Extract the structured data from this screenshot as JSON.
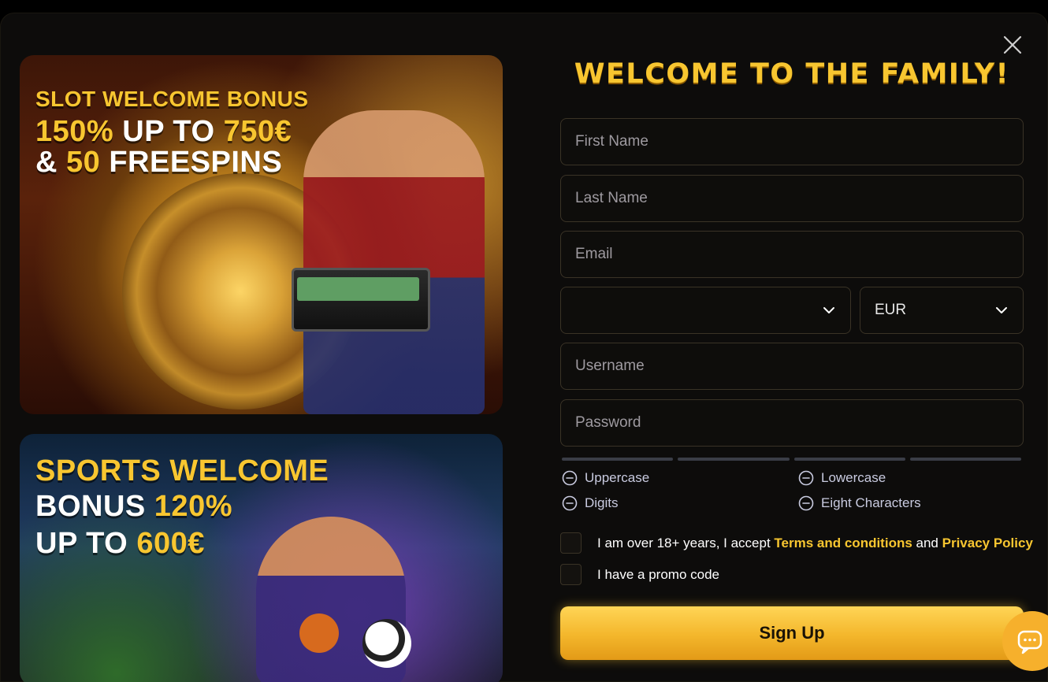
{
  "modal": {
    "title": "WELCOME TO THE FAMILY!"
  },
  "promos": {
    "slot": {
      "line1": "SLOT WELCOME BONUS",
      "line2_a": "150%",
      "line2_b": " UP TO ",
      "line2_c": "750€",
      "line3_a": "& ",
      "line3_b": "50",
      "line3_c": " FREESPINS"
    },
    "sports": {
      "line1": "SPORTS  WELCOME",
      "line2_a": "BONUS ",
      "line2_b": "120%",
      "line3_a": "UP TO ",
      "line3_b": "600€"
    }
  },
  "form": {
    "first_name_placeholder": "First Name",
    "last_name_placeholder": "Last Name",
    "email_placeholder": "Email",
    "country_value": "",
    "currency_value": "EUR",
    "username_placeholder": "Username",
    "password_placeholder": "Password",
    "password_rules": {
      "uppercase": "Uppercase",
      "lowercase": "Lowercase",
      "digits": "Digits",
      "eight_characters": "Eight Characters"
    },
    "terms": {
      "prefix": "I am over 18+ years, I accept ",
      "terms_link": "Terms and conditions",
      "and": " and ",
      "privacy_link": "Privacy Policy"
    },
    "promo_code_label": "I have a promo code",
    "signup_label": "Sign Up"
  },
  "icons": {
    "close": "close-icon",
    "chevron": "chevron-down-icon",
    "rule": "minus-circle-icon",
    "chat": "chat-icon"
  },
  "colors": {
    "accent": "#f8c630",
    "button": "#f3b62b",
    "field_border": "#3a3326"
  }
}
